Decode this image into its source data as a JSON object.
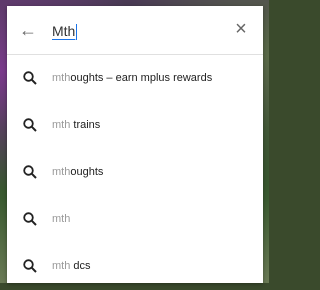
{
  "search": {
    "query": "Mth"
  },
  "suggestions": [
    {
      "typed": "mth",
      "rest": "oughts – earn mplus rewards"
    },
    {
      "typed": "mth",
      "rest": " trains"
    },
    {
      "typed": "mth",
      "rest": "oughts"
    },
    {
      "typed": "mth",
      "rest": ""
    },
    {
      "typed": "mth",
      "rest": " dcs"
    }
  ],
  "icons": {
    "back": "arrow-back-icon",
    "clear": "close-icon",
    "suggestion": "search-icon"
  },
  "colors": {
    "cursor": "#1a73e8",
    "typed_text": "#9a9a9a",
    "completion_text": "#222222"
  }
}
